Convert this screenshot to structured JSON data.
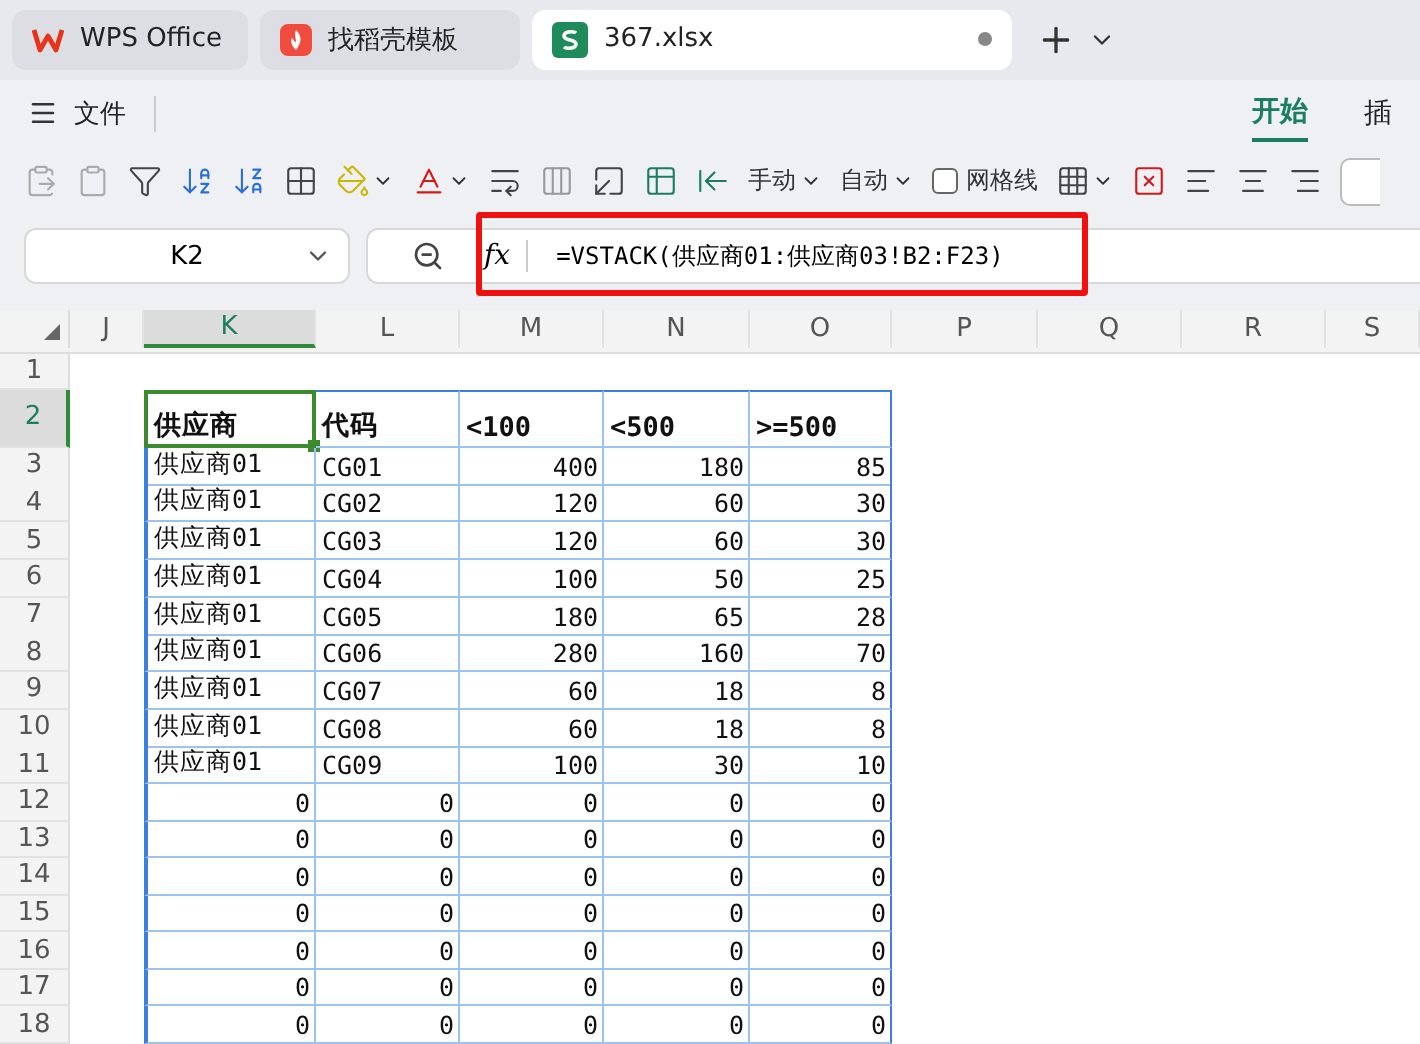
{
  "tabs": [
    {
      "label": "WPS Office",
      "kind": "wps",
      "selected": false
    },
    {
      "label": "找稻壳模板",
      "kind": "docer",
      "selected": false
    },
    {
      "label": "367.xlsx",
      "kind": "sheet",
      "selected": true
    }
  ],
  "menu": {
    "file": "文件",
    "ribbon_tabs": [
      {
        "label": "开始",
        "selected": true
      },
      {
        "label": "插",
        "selected": false
      }
    ]
  },
  "toolbar": {
    "row_height": "手动",
    "col_width": "自动",
    "gridlines": {
      "label": "网格线",
      "checked": false
    }
  },
  "formula_bar": {
    "name_box": "K2",
    "fx": "fx",
    "formula": "=VSTACK(供应商01:供应商03!B2:F23)"
  },
  "sheet": {
    "columns": [
      {
        "label": "J",
        "selected": false
      },
      {
        "label": "K",
        "selected": true
      },
      {
        "label": "L",
        "selected": false
      },
      {
        "label": "M",
        "selected": false
      },
      {
        "label": "N",
        "selected": false
      },
      {
        "label": "O",
        "selected": false
      },
      {
        "label": "P",
        "selected": false
      },
      {
        "label": "Q",
        "selected": false
      },
      {
        "label": "R",
        "selected": false
      },
      {
        "label": "S",
        "selected": false
      }
    ],
    "rows": [
      {
        "label": "1",
        "selected": false,
        "kind": "blank",
        "cells": []
      },
      {
        "label": "2",
        "selected": true,
        "kind": "header",
        "cells": [
          "",
          "供应商",
          "代码",
          "<100",
          "<500",
          ">=500"
        ]
      },
      {
        "label": "3",
        "selected": false,
        "kind": "record",
        "cells": [
          "",
          "供应商01",
          "CG01",
          "400",
          "180",
          "85"
        ]
      },
      {
        "label": "4",
        "selected": false,
        "kind": "record",
        "cells": [
          "",
          "供应商01",
          "CG02",
          "120",
          "60",
          "30"
        ]
      },
      {
        "label": "5",
        "selected": false,
        "kind": "record",
        "cells": [
          "",
          "供应商01",
          "CG03",
          "120",
          "60",
          "30"
        ]
      },
      {
        "label": "6",
        "selected": false,
        "kind": "record",
        "cells": [
          "",
          "供应商01",
          "CG04",
          "100",
          "50",
          "25"
        ]
      },
      {
        "label": "7",
        "selected": false,
        "kind": "record",
        "cells": [
          "",
          "供应商01",
          "CG05",
          "180",
          "65",
          "28"
        ]
      },
      {
        "label": "8",
        "selected": false,
        "kind": "record",
        "cells": [
          "",
          "供应商01",
          "CG06",
          "280",
          "160",
          "70"
        ]
      },
      {
        "label": "9",
        "selected": false,
        "kind": "record",
        "cells": [
          "",
          "供应商01",
          "CG07",
          "60",
          "18",
          "8"
        ]
      },
      {
        "label": "10",
        "selected": false,
        "kind": "record",
        "cells": [
          "",
          "供应商01",
          "CG08",
          "60",
          "18",
          "8"
        ]
      },
      {
        "label": "11",
        "selected": false,
        "kind": "record",
        "cells": [
          "",
          "供应商01",
          "CG09",
          "100",
          "30",
          "10"
        ]
      },
      {
        "label": "12",
        "selected": false,
        "kind": "zero",
        "cells": [
          "",
          "0",
          "0",
          "0",
          "0",
          "0"
        ]
      },
      {
        "label": "13",
        "selected": false,
        "kind": "zero",
        "cells": [
          "",
          "0",
          "0",
          "0",
          "0",
          "0"
        ]
      },
      {
        "label": "14",
        "selected": false,
        "kind": "zero",
        "cells": [
          "",
          "0",
          "0",
          "0",
          "0",
          "0"
        ]
      },
      {
        "label": "15",
        "selected": false,
        "kind": "zero",
        "cells": [
          "",
          "0",
          "0",
          "0",
          "0",
          "0"
        ]
      },
      {
        "label": "16",
        "selected": false,
        "kind": "zero",
        "cells": [
          "",
          "0",
          "0",
          "0",
          "0",
          "0"
        ]
      },
      {
        "label": "17",
        "selected": false,
        "kind": "zero",
        "cells": [
          "",
          "0",
          "0",
          "0",
          "0",
          "0"
        ]
      },
      {
        "label": "18",
        "selected": false,
        "kind": "zero",
        "cells": [
          "",
          "0",
          "0",
          "0",
          "0",
          "0"
        ]
      }
    ]
  }
}
